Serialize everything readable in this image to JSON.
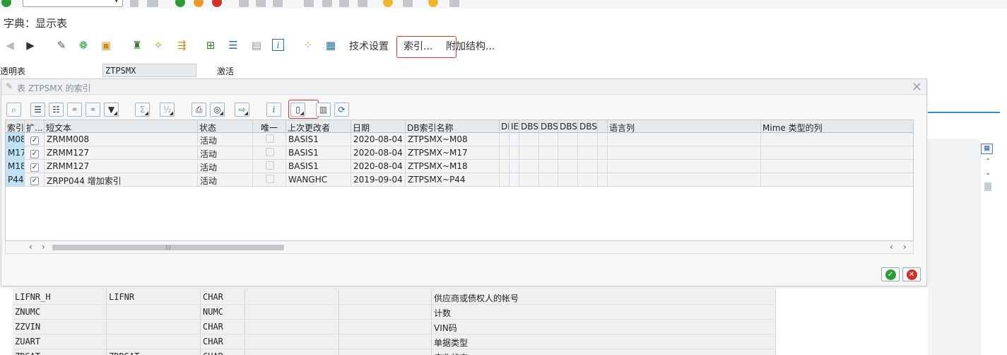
{
  "app": {
    "title": "字典：显示表"
  },
  "toolbar": {
    "tech_settings": "技术设置",
    "indexes": "索引...",
    "append_structures": "附加结构..."
  },
  "header_fields": {
    "table_label": "透明表",
    "table_name": "ZTPSMX",
    "status": "激活"
  },
  "dialog": {
    "title": "表 ZTPSMX 的索引",
    "columns": [
      "索引",
      "扩...",
      "短文本",
      "状态",
      "唯一",
      "上次更改者",
      "日期",
      "DB索引名称",
      "DI",
      "IE",
      "DBS",
      "DBS",
      "DBS",
      "DBS",
      "",
      "语言列",
      "Mime 类型的列"
    ],
    "rows": [
      {
        "index": "M08",
        "ext": "✓",
        "text": "ZRMM008",
        "status": "活动",
        "changed_by": "BASIS1",
        "date": "2020-08-04",
        "db_index": "ZTPSMX~M08"
      },
      {
        "index": "M17",
        "ext": "✓",
        "text": "ZRMM127",
        "status": "活动",
        "changed_by": "BASIS1",
        "date": "2020-08-04",
        "db_index": "ZTPSMX~M17"
      },
      {
        "index": "M18",
        "ext": "✓",
        "text": "ZRMM127",
        "status": "活动",
        "changed_by": "BASIS1",
        "date": "2020-08-04",
        "db_index": "ZTPSMX~M18"
      },
      {
        "index": "P44",
        "ext": "✓",
        "text": "ZRPP044 增加索引",
        "status": "活动",
        "changed_by": "WANGHC",
        "date": "2019-09-04",
        "db_index": "ZTPSMX~P44"
      }
    ]
  },
  "fields": [
    {
      "name": "LIFNR_H",
      "element": "LIFNR",
      "type": "CHAR",
      "desc": "供应商或债权人的帐号"
    },
    {
      "name": "ZNUMC",
      "element": "",
      "type": "NUMC",
      "desc": "计数"
    },
    {
      "name": "ZZVIN",
      "element": "",
      "type": "CHAR",
      "desc": "VIN码"
    },
    {
      "name": "ZUART",
      "element": "",
      "type": "CHAR",
      "desc": "单据类型"
    },
    {
      "name": "ZDSAT",
      "element": "ZDDSAT",
      "type": "CHAR",
      "desc": "应收状态"
    }
  ],
  "colors": {
    "accent_blue": "#2b8fd6",
    "highlight_red": "#e0332a",
    "key_cell": "#bfe3f6",
    "ok_green": "#2e9b3a",
    "cancel_red": "#d2312a"
  }
}
